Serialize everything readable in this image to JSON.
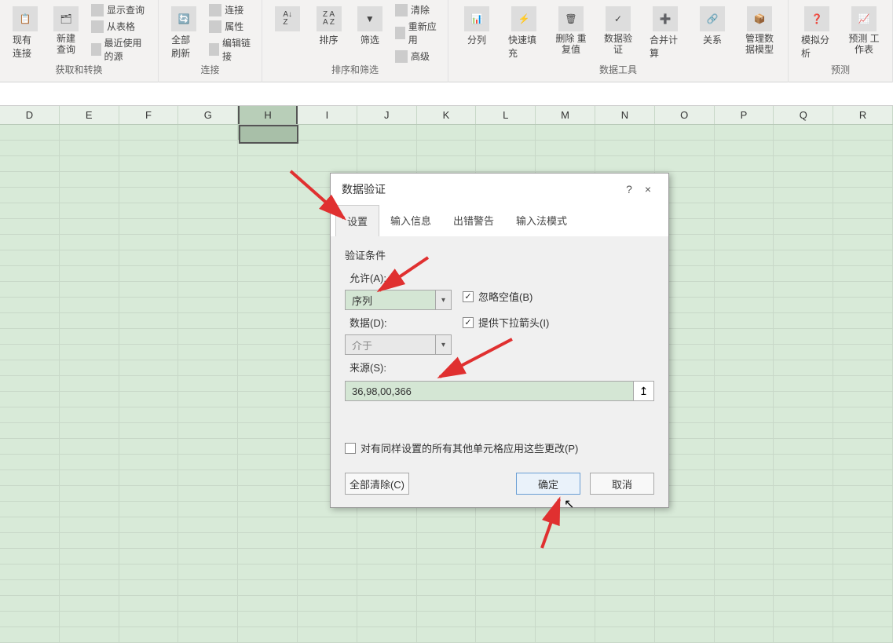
{
  "ribbon": {
    "groups": [
      {
        "items_large": [
          {
            "label": "现有连接"
          },
          {
            "label": "新建\n查询"
          }
        ],
        "subitems": [
          "显示查询",
          "从表格",
          "最近使用的源"
        ],
        "label": "获取和转换"
      },
      {
        "items_large": [
          {
            "label": "全部刷新"
          }
        ],
        "subitems": [
          "连接",
          "属性",
          "编辑链接"
        ],
        "label": "连接"
      },
      {
        "items_large": [
          {
            "label": ""
          },
          {
            "label": "排序"
          },
          {
            "label": "筛选"
          }
        ],
        "subitems": [
          "清除",
          "重新应用",
          "高级"
        ],
        "label": "排序和筛选"
      },
      {
        "items_large": [
          {
            "label": "分列"
          },
          {
            "label": "快速填充"
          },
          {
            "label": "删除\n重复值"
          },
          {
            "label": "数据验\n证"
          },
          {
            "label": "合并计算"
          },
          {
            "label": "关系"
          },
          {
            "label": "管理数\n据模型"
          }
        ],
        "subitems": [],
        "label": "数据工具"
      },
      {
        "items_large": [
          {
            "label": "模拟分析"
          },
          {
            "label": "预测\n工作表"
          }
        ],
        "subitems": [],
        "label": "预测"
      }
    ]
  },
  "columns": [
    "D",
    "E",
    "F",
    "G",
    "H",
    "I",
    "J",
    "K",
    "L",
    "M",
    "N",
    "O",
    "P",
    "Q",
    "R"
  ],
  "selected_column": "H",
  "dialog": {
    "title": "数据验证",
    "help": "?",
    "close": "×",
    "tabs": [
      "设置",
      "输入信息",
      "出错警告",
      "输入法模式"
    ],
    "active_tab": 0,
    "section_label": "验证条件",
    "allow_label": "允许(A):",
    "allow_value": "序列",
    "data_label": "数据(D):",
    "data_value": "介于",
    "checkbox_ignore_blank": "忽略空值(B)",
    "checkbox_ignore_blank_checked": true,
    "checkbox_dropdown": "提供下拉箭头(I)",
    "checkbox_dropdown_checked": true,
    "source_label": "来源(S):",
    "source_value": "36,98,00,366",
    "apply_changes": "对有同样设置的所有其他单元格应用这些更改(P)",
    "apply_changes_checked": false,
    "btn_clear": "全部清除(C)",
    "btn_ok": "确定",
    "btn_cancel": "取消"
  }
}
